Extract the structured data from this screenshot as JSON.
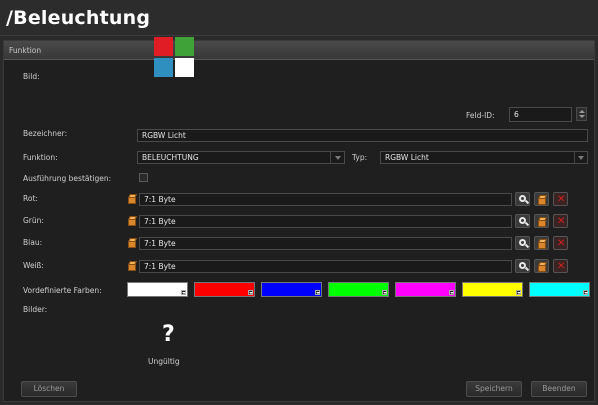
{
  "header": {
    "title": "/Beleuchtung"
  },
  "section": {
    "title": "Funktion"
  },
  "labels": {
    "bild": "Bild:",
    "feld_id": "Feld-ID:",
    "bezeichner": "Bezeichner:",
    "funktion": "Funktion:",
    "typ": "Typ:",
    "bestaetigen": "Ausführung bestätigen:",
    "rot": "Rot:",
    "gruen": "Grün:",
    "blau": "Blau:",
    "weiss": "Weiß:",
    "farben": "Vordefinierte Farben:",
    "bilder": "Bilder:"
  },
  "fields": {
    "feld_id": "6",
    "bezeichner": "RGBW Licht",
    "funktion": "BELEUCHTUNG",
    "typ": "RGBW Licht",
    "bestaetigen_checked": false
  },
  "channels": [
    {
      "value": "7:1 Byte"
    },
    {
      "value": "7:1 Byte"
    },
    {
      "value": "7:1 Byte"
    },
    {
      "value": "7:1 Byte"
    }
  ],
  "predefined_colors": [
    "#ffffff",
    "#ff0000",
    "#0000ff",
    "#00ff00",
    "#ff00ff",
    "#ffff00",
    "#00ffff"
  ],
  "bild_tile_colors": [
    "#e01c24",
    "#3ea238",
    "#2f8fbf",
    "#ffffff"
  ],
  "bilder": {
    "status": "Ungültig",
    "icon": "question-mark-icon"
  },
  "footer": {
    "delete": "Löschen",
    "save": "Speichern",
    "close": "Beenden"
  }
}
